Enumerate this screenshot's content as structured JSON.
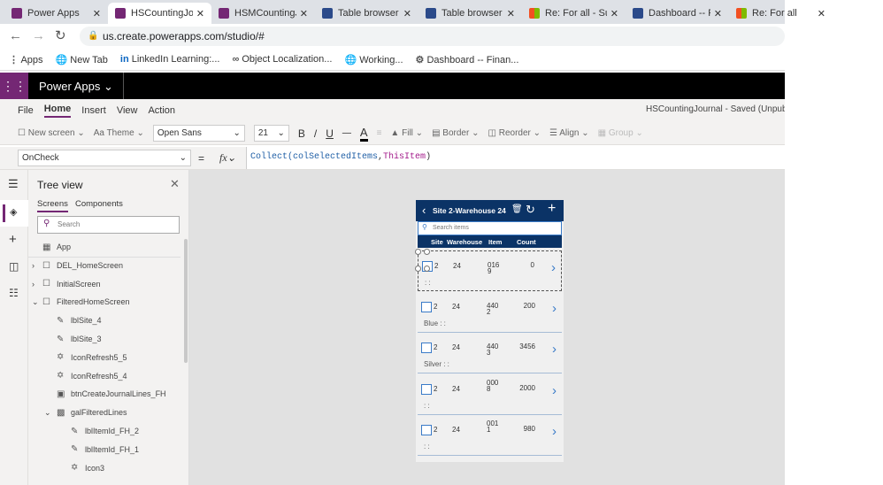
{
  "browser": {
    "tabs": [
      {
        "label": "Power Apps",
        "icon": "powerapps-icon",
        "active": false
      },
      {
        "label": "HSCountingJournal",
        "icon": "powerapps-icon",
        "active": true
      },
      {
        "label": "HSMCountingJ",
        "icon": "powerapps-icon",
        "active": false
      },
      {
        "label": "Table browser",
        "icon": "dynamics-icon",
        "active": false
      },
      {
        "label": "Table browser",
        "icon": "dynamics-icon",
        "active": false
      },
      {
        "label": "Re: For all - Su",
        "icon": "microsoft-icon",
        "active": false
      },
      {
        "label": "Dashboard -- Fi",
        "icon": "dynamics-icon",
        "active": false
      },
      {
        "label": "Re: For all",
        "icon": "microsoft-icon",
        "active": false
      }
    ],
    "url": "us.create.powerapps.com/studio/#",
    "bookmarks": [
      "Apps",
      "New Tab",
      "LinkedIn Learning:...",
      "Object Localization...",
      "Working...",
      "Dashboard -- Finan..."
    ]
  },
  "app": {
    "brand": "Power Apps",
    "accent": "#742774",
    "doc_status": "HSCountingJournal - Saved (Unpublished)"
  },
  "menu": [
    "File",
    "Home",
    "Insert",
    "View",
    "Action"
  ],
  "toolbar": {
    "new_screen": "New screen",
    "theme": "Theme",
    "font": "Open Sans",
    "size": "21",
    "bold": "B",
    "italic": "/",
    "underline": "U",
    "fill": "Fill",
    "border": "Border",
    "reorder": "Reorder",
    "align": "Align",
    "group": "Group"
  },
  "formula": {
    "property": "OnCheck",
    "eq": "=",
    "fx": "fx",
    "expr_fn": "Collect(",
    "expr_arg1": "colSelectedItems",
    "expr_sep": ",",
    "expr_arg2": "ThisItem",
    "expr_end": ")"
  },
  "tree": {
    "title": "Tree view",
    "tabs": [
      "Screens",
      "Components"
    ],
    "search_placeholder": "Search",
    "items": [
      {
        "label": "App",
        "level": 0
      },
      {
        "label": "DEL_HomeScreen",
        "level": 0
      },
      {
        "label": "InitialScreen",
        "level": 0
      },
      {
        "label": "FilteredHomeScreen",
        "level": 0
      },
      {
        "label": "lblSite_4",
        "level": 1
      },
      {
        "label": "lblSite_3",
        "level": 1
      },
      {
        "label": "IconRefresh5_5",
        "level": 1
      },
      {
        "label": "IconRefresh5_4",
        "level": 1
      },
      {
        "label": "btnCreateJournalLines_FH",
        "level": 1
      },
      {
        "label": "galFilteredLines",
        "level": 1
      },
      {
        "label": "lblItemId_FH_2",
        "level": 2
      },
      {
        "label": "lblItemId_FH_1",
        "level": 2
      },
      {
        "label": "Icon3",
        "level": 2
      }
    ]
  },
  "phone": {
    "title": "Site 2-Warehouse 24",
    "header_color": "#0b3366",
    "search_placeholder": "Search items",
    "columns": [
      "Site",
      "Warehouse",
      "Item",
      "Count"
    ],
    "rows": [
      {
        "site": "2",
        "warehouse": "24",
        "item": "0169",
        "count": "0",
        "sub": ": :"
      },
      {
        "site": "2",
        "warehouse": "24",
        "item": "4402",
        "count": "200",
        "sub": "Blue : :"
      },
      {
        "site": "2",
        "warehouse": "24",
        "item": "4403",
        "count": "3456",
        "sub": "Silver : :"
      },
      {
        "site": "2",
        "warehouse": "24",
        "item": "0008",
        "count": "2000",
        "sub": ": :"
      },
      {
        "site": "2",
        "warehouse": "24",
        "item": "0011",
        "count": "980",
        "sub": ": :"
      }
    ]
  }
}
